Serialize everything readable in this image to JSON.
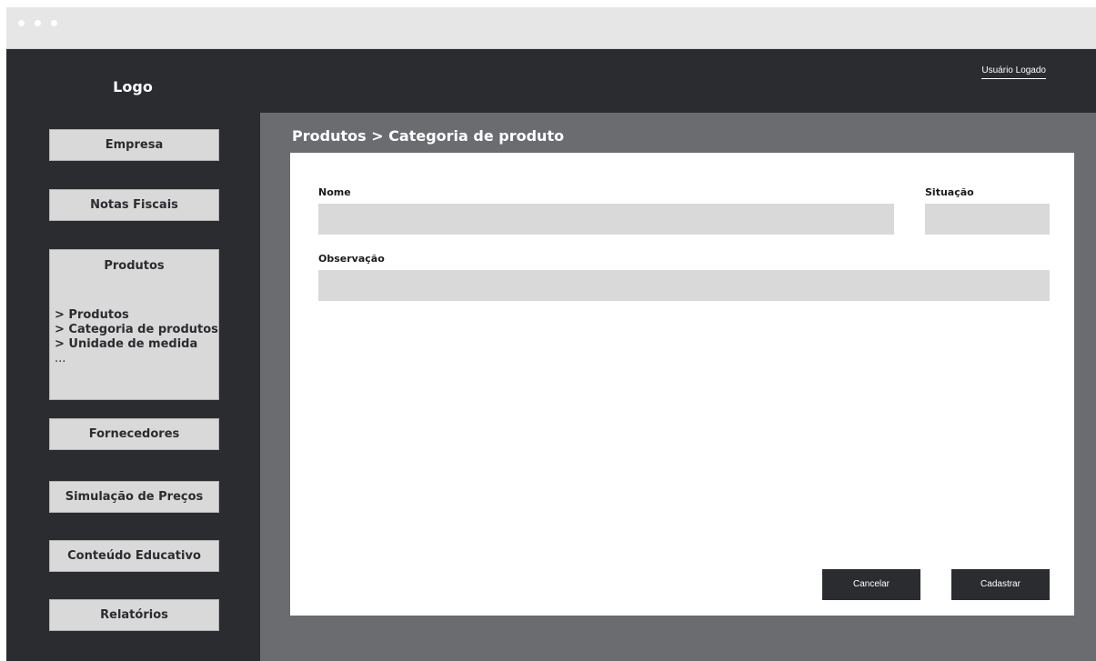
{
  "header": {
    "logo": "Logo",
    "user": "Usuário Logado"
  },
  "sidebar": {
    "items": [
      {
        "label": "Empresa"
      },
      {
        "label": "Notas Fiscais"
      },
      {
        "label": "Produtos",
        "submenu": [
          "> Produtos",
          "> Categoria de produtos",
          "> Unidade de medida",
          "..."
        ]
      },
      {
        "label": "Fornecedores"
      },
      {
        "label": "Simulação de Preços"
      },
      {
        "label": "Conteúdo Educativo"
      },
      {
        "label": "Relatórios"
      }
    ]
  },
  "main": {
    "breadcrumb": "Produtos > Categoria de produto",
    "form": {
      "nome_label": "Nome",
      "nome_value": "",
      "situacao_label": "Situação",
      "situacao_value": "",
      "observacao_label": "Observação",
      "observacao_value": ""
    },
    "actions": {
      "cancel_label": "Cancelar",
      "submit_label": "Cadastrar"
    }
  },
  "colors": {
    "sidebar_bg": "#2b2c30",
    "content_bg": "#6b6c70",
    "nav_button_bg": "#d9d9d9",
    "input_bg": "#d9d9d9",
    "button_bg": "#2b2c30"
  }
}
